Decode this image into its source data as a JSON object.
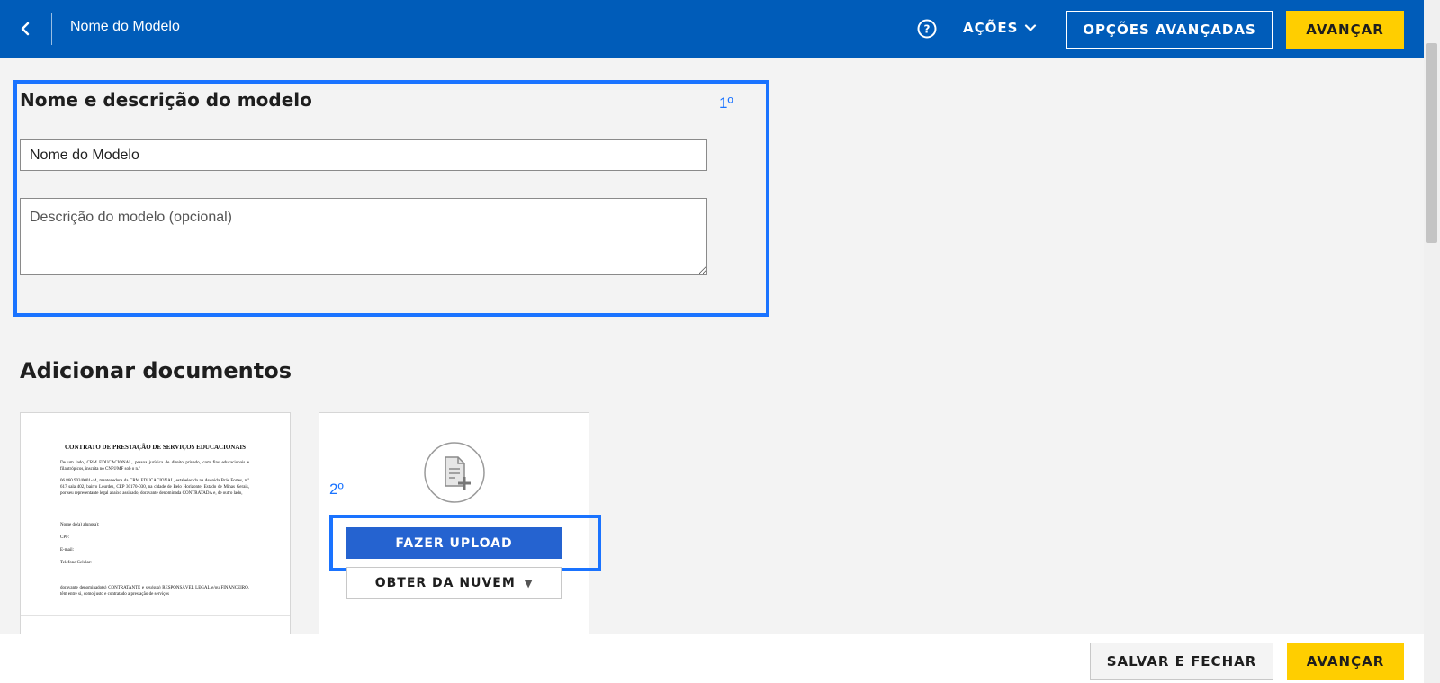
{
  "header": {
    "title": "Nome do Modelo",
    "actions_label": "AÇÕES",
    "advanced_options_label": "OPÇÕES AVANÇADAS",
    "advance_label": "AVANÇAR",
    "icons": {
      "back": "chevron-left-icon",
      "help": "help-circle-icon",
      "actions_dropdown": "chevron-down-icon"
    }
  },
  "section_name": {
    "title": "Nome e descrição do modelo",
    "step_marker": "1º",
    "name_value": "Nome do Modelo",
    "description_placeholder": "Descrição do modelo (opcional)"
  },
  "section_documents": {
    "title": "Adicionar documentos",
    "step_marker": "2º",
    "document_preview": {
      "heading": "CONTRATO DE PRESTAÇÃO DE SERVIÇOS EDUCACIONAIS",
      "paragraph1": "De um lado, CRM EDUCACIONAL, pessoa jurídica de direito privado, com fins educacionais e filantrópicos, inscrita no CNPJ/MF sob o n.º",
      "paragraph2": "06.860.903/0001-44, mantenedora da CRM EDUCACIONAL, estabelecida na Avenida Brás Fortes, n.º 617 sala 402, bairro Lourdes, CEP 30170-030, na cidade de Belo Horizonte, Estado de Minas Gerais, por seu representante legal abaixo assinado, doravante denominada CONTRATADA e, de outro lado,",
      "field_name": "Nome do(a) aluno(a):",
      "field_cpf": "CPF:",
      "field_email": "E-mail:",
      "field_phone": "Telefone Celular:",
      "paragraph3": "doravante denominado(s) CONTRATANTE e seu(sua) RESPONSÁVEL LEGAL e/ou FINANCEIRO, têm entre si, como justo e contratado a prestação de serviços"
    },
    "upload_button_label": "FAZER UPLOAD",
    "cloud_button_label": "OBTER DA NUVEM",
    "icons": {
      "add_document": "add-document-icon",
      "cloud_dropdown": "triangle-down-icon"
    }
  },
  "footer": {
    "save_close_label": "SALVAR E FECHAR",
    "advance_label": "AVANÇAR"
  },
  "colors": {
    "header_bg": "#005cb9",
    "accent_yellow": "#ffce00",
    "highlight_blue": "#1a73ff",
    "upload_button": "#2563d0"
  }
}
